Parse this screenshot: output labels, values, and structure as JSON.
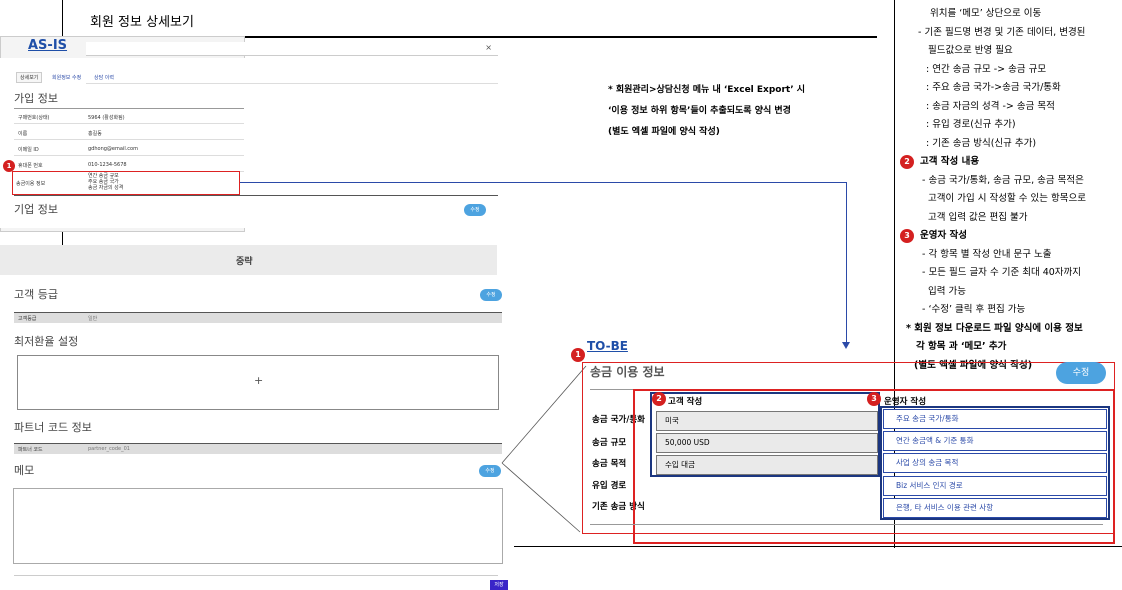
{
  "page": {
    "title": "회원 정보 상세보기"
  },
  "asis": {
    "label": "AS-IS",
    "close": "×",
    "tabs": [
      "상세보기",
      "회원정보 수정",
      "상담 이력"
    ],
    "join_title": "가입 정보",
    "rows": [
      {
        "k": "구매번호(상태)",
        "v": "5964 (활성화됨)"
      },
      {
        "k": "이름",
        "v": "홍길동"
      },
      {
        "k": "이메일 ID",
        "v": "gdhong@email.com"
      },
      {
        "k": "휴대폰 번호",
        "v": "010-1234-5678"
      }
    ],
    "usage_row": {
      "k": "송금이용 정보",
      "v1": "연간 송금 규모",
      "v2": "주요 송금 국가",
      "v3": "송금 자금의 성격"
    },
    "company_title": "기업 정보",
    "edit": "수정",
    "omitted": "중략",
    "grade_title": "고객 등급",
    "grade_row": {
      "k": "고객등급",
      "v": "일반"
    },
    "rate_title": "최저환율 설정",
    "plus": "+",
    "partner_title": "파트너 코드 정보",
    "partner_row": {
      "k": "파트너 코드",
      "v": "partner_code_01"
    },
    "memo_title": "메모",
    "save": "저장"
  },
  "notes": {
    "line1": "* 회원관리>상담신청 메뉴 내 ‘Excel Export’ 시",
    "line2": "‘이용 정보 하위 항목’들이 추출되도록 양식 변경",
    "line3": "(별도 엑셀 파일에 양식 작성)"
  },
  "right": [
    "위치를 ‘메모’ 상단으로 이동",
    "- 기존 필드명 변경 및 기존 데이터, 변경된",
    "필드값으로 반영 필요",
    ": 연간 송금 규모 -> 송금 규모",
    ": 주요 송금 국가->송금 국가/통화",
    ": 송금 자금의 성격 -> 송금 목적",
    ": 유입 경로(신규 추가)",
    ": 기존 송금 방식(신규 추가)",
    "고객 작성 내용",
    "- 송금 국가/통화, 송금 규모, 송금 목적은",
    "고객이 가입 시 작성할 수 있는 항목으로",
    "고객 입력 값은 편집 불가",
    "운영자 작성",
    "- 각 항목 별 작성 안내 문구 노출",
    "- 모든 필드 글자 수 기준 최대 40자까지",
    "입력 가능",
    "- ‘수정’ 클릭 후 편집 가능",
    "* 회원 정보 다운로드 파일 양식에 이용 정보",
    "각 항목 과 ‘메모’ 추가",
    "(별도 엑셀 파일에 양식 작성)"
  ],
  "tobe": {
    "label": "TO-BE",
    "section_title": "송금 이용 정보",
    "edit": "수정",
    "col_customer": "고객 작성",
    "col_operator": "운영자 작성",
    "labels": [
      "송금 국가/통화",
      "송금 규모",
      "송금 목적",
      "유입 경로",
      "기존 송금 방식"
    ],
    "customer_values": [
      "미국",
      "50,000 USD",
      "수입 대금"
    ],
    "operator_values": [
      "주요 송금 국가/통화",
      "연간 송금액 & 기준 통화",
      "사업 상의 송금 목적",
      "Biz 서비스 인지 경로",
      "은행, 타 서비스 이용 관련 사항"
    ]
  },
  "badges": [
    "1",
    "2",
    "3"
  ],
  "colors": {
    "accent_blue": "#2b4aa8",
    "badge_red": "#d42020",
    "pill_blue": "#4da3e0"
  }
}
